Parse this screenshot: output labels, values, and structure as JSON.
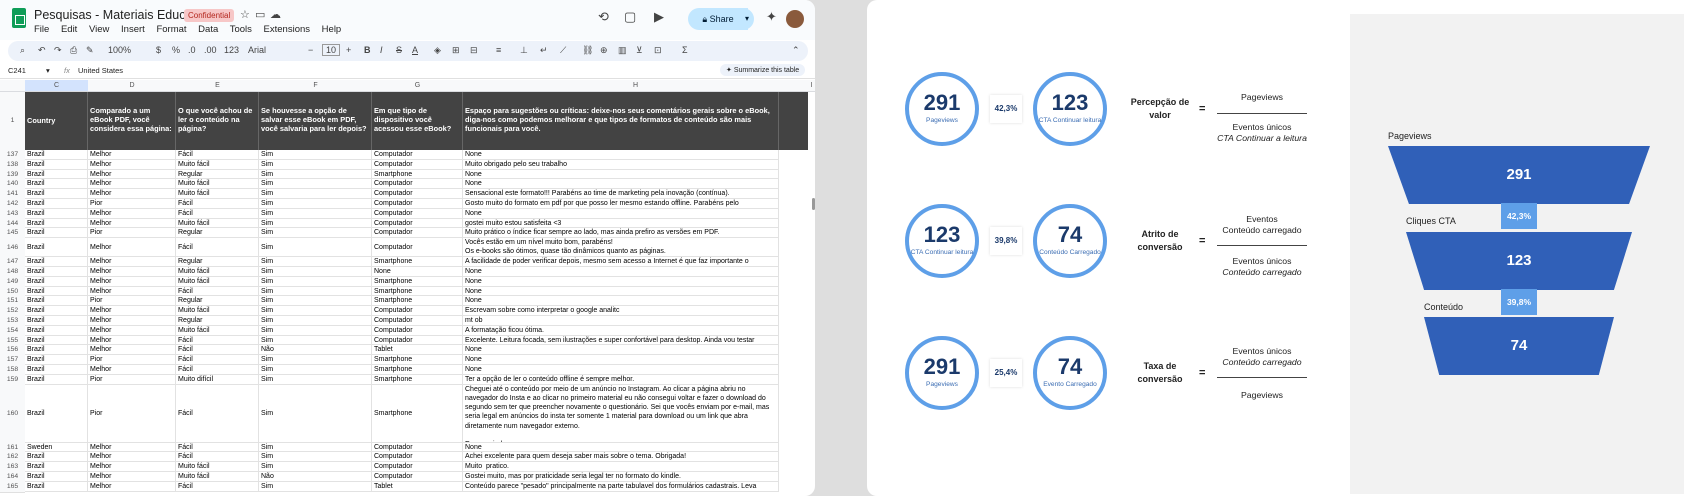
{
  "sheet": {
    "title": "Pesquisas - Materiais Educativos",
    "badge": "Confidential",
    "menu": [
      "File",
      "Edit",
      "View",
      "Insert",
      "Format",
      "Data",
      "Tools",
      "Extensions",
      "Help"
    ],
    "share_label": "Share",
    "toolbar": {
      "zoom": "100%",
      "currency": "$",
      "percent": "%",
      "dec_less": ".0",
      "dec_more": ".00",
      "number_fmt": "123",
      "font": "Arial",
      "font_size": "10",
      "bold": "B",
      "italic": "I",
      "strike": "S",
      "text_color": "A",
      "sum": "Σ"
    },
    "cell_ref": "C241",
    "fx": "fx",
    "formula_value": "United States",
    "summarize_label": "Summarize this table",
    "col_letters": [
      "C",
      "D",
      "E",
      "F",
      "G",
      "H",
      "I"
    ],
    "header_row_num": "1",
    "headers": [
      "Country",
      "Comparado a um eBook PDF, você considera essa página:",
      "O que você achou de ler o conteúdo na página?",
      "Se houvesse a opção de salvar esse eBook em PDF, você salvaria para ler depois?",
      "Em que tipo de dispositivo você acessou esse eBook?",
      "Espaço para sugestões ou críticas: deixe-nos seus comentários gerais sobre o eBook, diga-nos como podemos melhorar e que tipos de formatos de conteúdo são mais funcionais para você."
    ],
    "rows": [
      {
        "n": "137",
        "c": [
          "Brazil",
          "Melhor",
          "Fácil",
          "Sim",
          "Computador",
          "None"
        ]
      },
      {
        "n": "138",
        "c": [
          "Brazil",
          "Melhor",
          "Muito fácil",
          "Sim",
          "Computador",
          "Muito obrigado pelo seu trabalho"
        ]
      },
      {
        "n": "139",
        "c": [
          "Brazil",
          "Melhor",
          "Regular",
          "Sim",
          "Smartphone",
          "None"
        ]
      },
      {
        "n": "140",
        "c": [
          "Brazil",
          "Melhor",
          "Muito fácil",
          "Sim",
          "Computador",
          "None"
        ]
      },
      {
        "n": "141",
        "c": [
          "Brazil",
          "Melhor",
          "Muito fácil",
          "Sim",
          "Computador",
          "Sensacional este formato!!! Parabéns ao time de marketing pela inovação (contínua)."
        ]
      },
      {
        "n": "142",
        "c": [
          "Brazil",
          "Pior",
          "Fácil",
          "Sim",
          "Computador",
          "Gosto muito do formato em pdf por que posso ler mesmo estando offline. Parabéns pelo"
        ]
      },
      {
        "n": "143",
        "c": [
          "Brazil",
          "Melhor",
          "Fácil",
          "Sim",
          "Computador",
          "None"
        ]
      },
      {
        "n": "144",
        "c": [
          "Brazil",
          "Melhor",
          "Muito fácil",
          "Sim",
          "Computador",
          "gostei muito estou satisfeita <3"
        ]
      },
      {
        "n": "145",
        "c": [
          "Brazil",
          "Pior",
          "Regular",
          "Sim",
          "Computador",
          "Muito prático o índice ficar sempre ao lado, mas ainda prefiro as versões em PDF."
        ]
      },
      {
        "n": "146",
        "c": [
          "Brazil",
          "Melhor",
          "Fácil",
          "Sim",
          "Computador",
          "Vocês estão em um nível muito bom, parabéns!\nOs e-books são ótimos, quase tão dinâmicos quanto as páginas."
        ]
      },
      {
        "n": "147",
        "c": [
          "Brazil",
          "Melhor",
          "Regular",
          "Sim",
          "Smartphone",
          "A facilidade de poder verificar depois, mesmo sem acesso a Internet é que faz importante o"
        ]
      },
      {
        "n": "148",
        "c": [
          "Brazil",
          "Melhor",
          "Muito fácil",
          "Sim",
          "None",
          "None"
        ]
      },
      {
        "n": "149",
        "c": [
          "Brazil",
          "Melhor",
          "Muito fácil",
          "Sim",
          "Smartphone",
          "None"
        ]
      },
      {
        "n": "150",
        "c": [
          "Brazil",
          "Melhor",
          "Fácil",
          "Sim",
          "Smartphone",
          "None"
        ]
      },
      {
        "n": "151",
        "c": [
          "Brazil",
          "Pior",
          "Regular",
          "Sim",
          "Smartphone",
          "None"
        ]
      },
      {
        "n": "152",
        "c": [
          "Brazil",
          "Melhor",
          "Muito fácil",
          "Sim",
          "Computador",
          "Escrevam sobre como interpretar o google analitc"
        ]
      },
      {
        "n": "153",
        "c": [
          "Brazil",
          "Melhor",
          "Regular",
          "Sim",
          "Computador",
          "mt ob"
        ]
      },
      {
        "n": "154",
        "c": [
          "Brazil",
          "Melhor",
          "Muito fácil",
          "Sim",
          "Computador",
          "A formatação ficou ótima."
        ]
      },
      {
        "n": "155",
        "c": [
          "Brazil",
          "Melhor",
          "Fácil",
          "Sim",
          "Computador",
          "Excelente. Leitura focada, sem ilustrações e super confortável para desktop. Ainda vou testar"
        ]
      },
      {
        "n": "156",
        "c": [
          "Brazil",
          "Melhor",
          "Fácil",
          "Não",
          "Tablet",
          "None"
        ]
      },
      {
        "n": "157",
        "c": [
          "Brazil",
          "Pior",
          "Fácil",
          "Sim",
          "Smartphone",
          "None"
        ]
      },
      {
        "n": "158",
        "c": [
          "Brazil",
          "Melhor",
          "Fácil",
          "Sim",
          "Smartphone",
          "None"
        ]
      },
      {
        "n": "159",
        "c": [
          "Brazil",
          "Pior",
          "Muito difícil",
          "Sim",
          "Smartphone",
          "Ter a opção de ler o conteúdo offline é sempre melhor."
        ]
      },
      {
        "n": "160",
        "c": [
          "Brazil",
          "Pior",
          "Fácil",
          "Sim",
          "Smartphone",
          "Cheguei até o conteúdo por meio de um anúncio no Instagram. Ao clicar a página abriu no navegador do Insta e ao clicar no primeiro material eu não consegui voltar e fazer o download do segundo sem ter que preencher novamente o questionário. Sei que vocês enviam por e-mail, mas seria legal em anúncios do insta ter somente 1 material para download ou um link que abra diretamente num navegador externo.\n\nEspero ajudar"
        ]
      },
      {
        "n": "161",
        "c": [
          "Sweden",
          "Melhor",
          "Fácil",
          "Sim",
          "Computador",
          "None"
        ]
      },
      {
        "n": "162",
        "c": [
          "Brazil",
          "Melhor",
          "Fácil",
          "Sim",
          "Computador",
          "Achei excelente para quem deseja saber mais sobre o tema. Obrigada!"
        ]
      },
      {
        "n": "163",
        "c": [
          "Brazil",
          "Melhor",
          "Muito fácil",
          "Sim",
          "Computador",
          "Muito  pratico."
        ]
      },
      {
        "n": "164",
        "c": [
          "Brazil",
          "Melhor",
          "Muito fácil",
          "Não",
          "Computador",
          "Gostei muito, mas por praticidade seria legal ter no formato do kindle."
        ]
      },
      {
        "n": "165",
        "c": [
          "Brazil",
          "Melhor",
          "Fácil",
          "Sim",
          "Tablet",
          "Conteúdo parece \"pesado\" principalmente na parte tabulavel dos formulários cadastrais. Leva"
        ]
      }
    ]
  },
  "metrics": [
    {
      "left_value": "291",
      "left_label": "Pageviews",
      "pct": "42,3%",
      "right_value": "123",
      "right_label": "CTA Continuar leitura",
      "name": "Percepção de valor",
      "numerator": "Pageviews",
      "denominator_1": "Eventos únicos",
      "denominator_2": "CTA Continuar a leitura"
    },
    {
      "left_value": "123",
      "left_label": "CTA Continuar leitura",
      "pct": "39,8%",
      "right_value": "74",
      "right_label": "Conteúdo Carregado",
      "name": "Atrito de conversão",
      "numerator_1": "Eventos",
      "numerator_2": "Conteúdo carregado",
      "denominator_1": "Eventos únicos",
      "denominator_2": "Conteúdo carregado"
    },
    {
      "left_value": "291",
      "left_label": "Pageviews",
      "pct": "25,4%",
      "right_value": "74",
      "right_label": "Evento Carregado",
      "name": "Taxa de conversão",
      "numerator_1": "Eventos únicos",
      "numerator_2": "Conteúdo carregado",
      "denominator": "Pageviews"
    }
  ],
  "equals": "=",
  "funnel": {
    "stages": [
      {
        "label": "Pageviews",
        "value": "291"
      },
      {
        "label": "Cliques CTA",
        "value": "123"
      },
      {
        "label": "Conteúdo",
        "value": "74"
      }
    ],
    "rates": [
      "42,3%",
      "39,8%"
    ]
  },
  "colors": {
    "accent": "#3060b8",
    "circle_border": "#5e9fe8",
    "header_bg": "#434343"
  }
}
